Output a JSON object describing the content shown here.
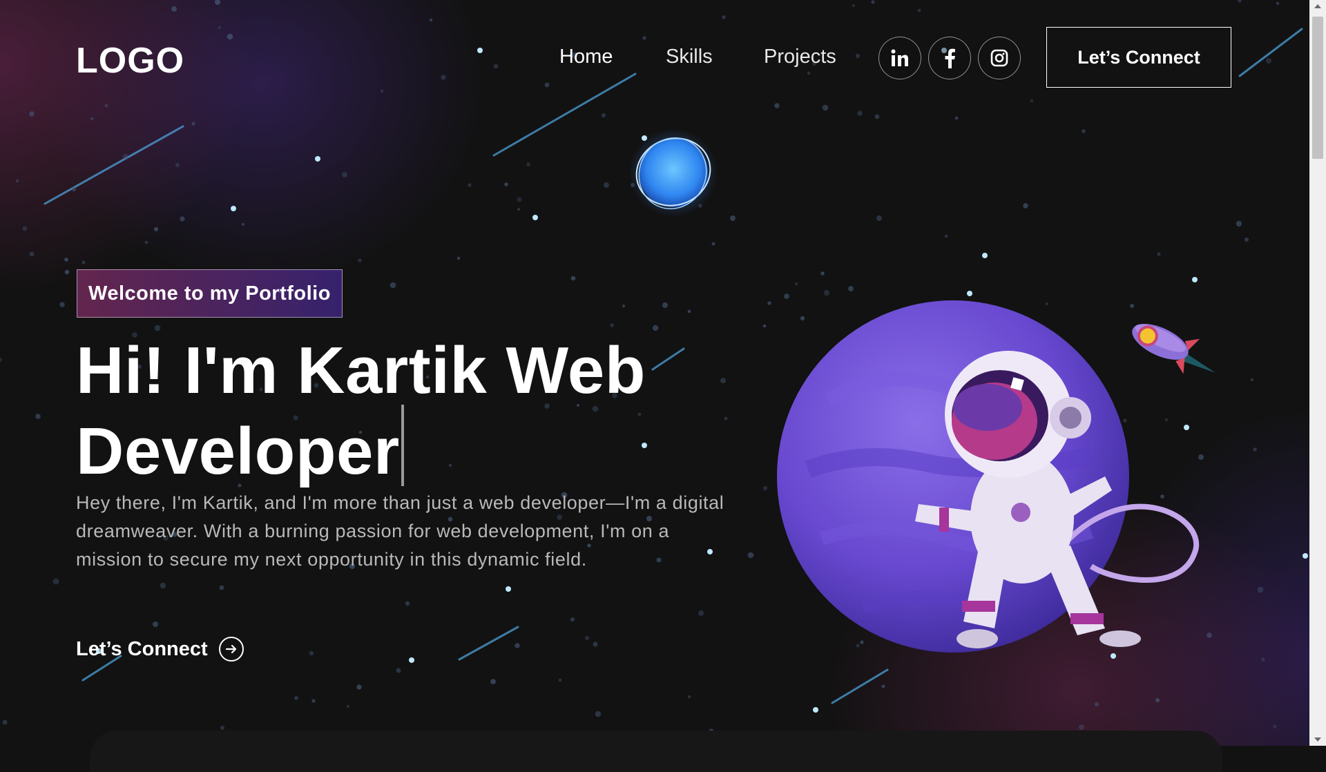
{
  "navbar": {
    "logo": "LOGO",
    "links": [
      {
        "label": "Home"
      },
      {
        "label": "Skills"
      },
      {
        "label": "Projects"
      }
    ],
    "social_icons": [
      "linkedin-icon",
      "facebook-icon",
      "instagram-icon"
    ],
    "connect_label": "Let’s Connect"
  },
  "hero": {
    "tagline": "Welcome to my Portfolio",
    "title_line1": "Hi! I'm Kartik Web",
    "title_line2": "Developer",
    "description": "Hey there, I'm Kartik, and I'm more than just a web developer—I'm a digital dreamweaver. With a burning passion for web development, I'm on a mission to secure my next opportunity in this dynamic field.",
    "cta_label": "Let’s Connect"
  },
  "colors": {
    "background": "#121212",
    "tagline_gradient_start": "#AA367C",
    "tagline_gradient_end": "#4A2FBD",
    "planet": "#6a4cc9",
    "text_muted": "#b9b9b9"
  }
}
